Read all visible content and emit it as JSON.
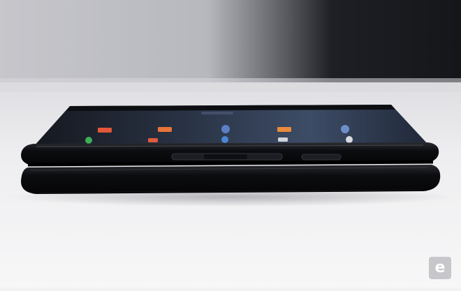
{
  "photo": {
    "subject": "foldable-phone-folded-side-view",
    "colors": {
      "background_light": "#c9c9cd",
      "background_dark": "#1b1c21",
      "table": "#efeff1",
      "phone_body": "#0b0c0f",
      "screen": "#1f2a3a"
    }
  },
  "watermark": {
    "brand": "engadget",
    "glyph": "e"
  }
}
